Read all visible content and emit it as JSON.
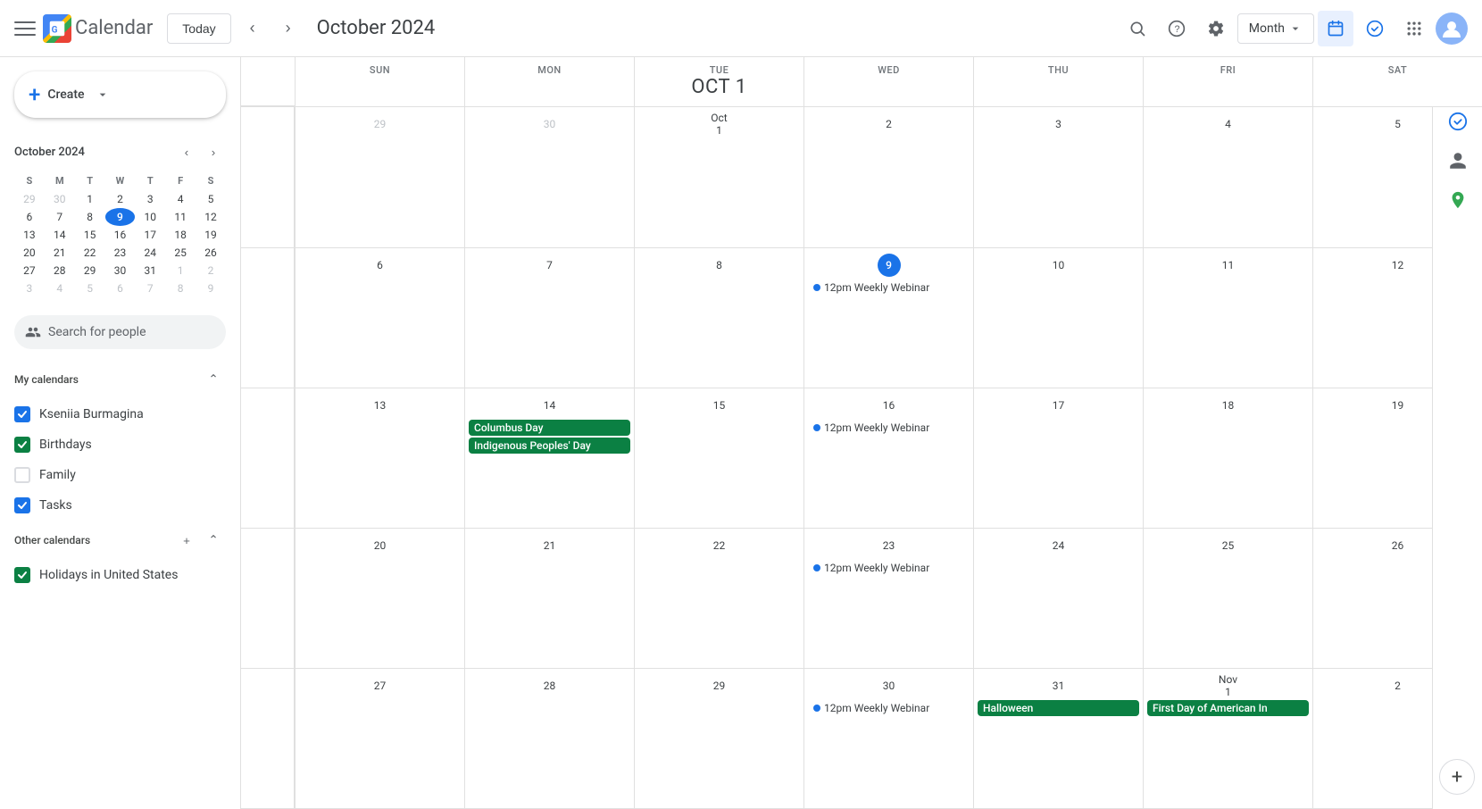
{
  "header": {
    "title": "October 2024",
    "today_label": "Today",
    "view_label": "Month",
    "logo_text": "Calendar"
  },
  "sidebar": {
    "create_label": "Create",
    "mini_cal": {
      "title": "October 2024",
      "days_header": [
        "S",
        "M",
        "T",
        "W",
        "T",
        "F",
        "S"
      ],
      "weeks": [
        [
          {
            "n": "29",
            "other": true
          },
          {
            "n": "30",
            "other": true
          },
          {
            "n": "1"
          },
          {
            "n": "2"
          },
          {
            "n": "3"
          },
          {
            "n": "4"
          },
          {
            "n": "5"
          }
        ],
        [
          {
            "n": "6"
          },
          {
            "n": "7"
          },
          {
            "n": "8"
          },
          {
            "n": "9",
            "today": true
          },
          {
            "n": "10"
          },
          {
            "n": "11"
          },
          {
            "n": "12"
          }
        ],
        [
          {
            "n": "13"
          },
          {
            "n": "14"
          },
          {
            "n": "15"
          },
          {
            "n": "16"
          },
          {
            "n": "17"
          },
          {
            "n": "18"
          },
          {
            "n": "19"
          }
        ],
        [
          {
            "n": "20"
          },
          {
            "n": "21"
          },
          {
            "n": "22"
          },
          {
            "n": "23"
          },
          {
            "n": "24"
          },
          {
            "n": "25"
          },
          {
            "n": "26"
          }
        ],
        [
          {
            "n": "27"
          },
          {
            "n": "28"
          },
          {
            "n": "29"
          },
          {
            "n": "30"
          },
          {
            "n": "31"
          },
          {
            "n": "1",
            "other": true
          },
          {
            "n": "2",
            "other": true
          }
        ],
        [
          {
            "n": "3",
            "other": true
          },
          {
            "n": "4",
            "other": true
          },
          {
            "n": "5",
            "other": true
          },
          {
            "n": "6",
            "other": true
          },
          {
            "n": "7",
            "other": true
          },
          {
            "n": "8",
            "other": true
          },
          {
            "n": "9",
            "other": true
          }
        ]
      ]
    },
    "search_placeholder": "Search for people",
    "my_calendars": {
      "label": "My calendars",
      "items": [
        {
          "name": "Kseniia Burmagina",
          "checked": true,
          "color": "#1a73e8"
        },
        {
          "name": "Birthdays",
          "checked": true,
          "color": "#0b8043"
        },
        {
          "name": "Family",
          "checked": false,
          "color": "none"
        },
        {
          "name": "Tasks",
          "checked": true,
          "color": "#1a73e8"
        }
      ]
    },
    "other_calendars": {
      "label": "Other calendars",
      "items": [
        {
          "name": "Holidays in United States",
          "checked": true,
          "color": "#0b8043"
        }
      ]
    }
  },
  "calendar": {
    "col_headers": [
      {
        "day": "SUN",
        "num": ""
      },
      {
        "day": "MON",
        "num": ""
      },
      {
        "day": "TUE",
        "num": "Oct 1",
        "is_today": false
      },
      {
        "day": "WED",
        "num": ""
      },
      {
        "day": "THU",
        "num": ""
      },
      {
        "day": "FRI",
        "num": ""
      },
      {
        "day": "SAT",
        "num": ""
      }
    ],
    "weeks": [
      {
        "days": [
          {
            "num": "29",
            "other": true,
            "events": []
          },
          {
            "num": "30",
            "other": true,
            "events": []
          },
          {
            "num": "Oct 1",
            "other": false,
            "events": []
          },
          {
            "num": "2",
            "other": false,
            "events": []
          },
          {
            "num": "3",
            "other": false,
            "events": []
          },
          {
            "num": "4",
            "other": false,
            "events": []
          },
          {
            "num": "5",
            "other": false,
            "events": []
          }
        ]
      },
      {
        "days": [
          {
            "num": "6",
            "other": false,
            "events": []
          },
          {
            "num": "7",
            "other": false,
            "events": []
          },
          {
            "num": "8",
            "other": false,
            "events": []
          },
          {
            "num": "9",
            "today": true,
            "other": false,
            "events": [
              {
                "type": "dot",
                "text": "12pm Weekly Webinar"
              }
            ]
          },
          {
            "num": "10",
            "other": false,
            "events": []
          },
          {
            "num": "11",
            "other": false,
            "events": []
          },
          {
            "num": "12",
            "other": false,
            "events": []
          }
        ]
      },
      {
        "days": [
          {
            "num": "13",
            "other": false,
            "events": []
          },
          {
            "num": "14",
            "other": false,
            "events": [
              {
                "type": "chip",
                "text": "Columbus Day",
                "color": "green"
              },
              {
                "type": "chip",
                "text": "Indigenous Peoples' Day",
                "color": "green"
              }
            ]
          },
          {
            "num": "15",
            "other": false,
            "events": []
          },
          {
            "num": "16",
            "other": false,
            "events": [
              {
                "type": "dot",
                "text": "12pm Weekly Webinar"
              }
            ]
          },
          {
            "num": "17",
            "other": false,
            "events": []
          },
          {
            "num": "18",
            "other": false,
            "events": []
          },
          {
            "num": "19",
            "other": false,
            "events": []
          }
        ]
      },
      {
        "days": [
          {
            "num": "20",
            "other": false,
            "events": []
          },
          {
            "num": "21",
            "other": false,
            "events": []
          },
          {
            "num": "22",
            "other": false,
            "events": []
          },
          {
            "num": "23",
            "other": false,
            "events": [
              {
                "type": "dot",
                "text": "12pm Weekly Webinar"
              }
            ]
          },
          {
            "num": "24",
            "other": false,
            "events": []
          },
          {
            "num": "25",
            "other": false,
            "events": []
          },
          {
            "num": "26",
            "other": false,
            "events": []
          }
        ]
      },
      {
        "days": [
          {
            "num": "27",
            "other": false,
            "events": []
          },
          {
            "num": "28",
            "other": false,
            "events": []
          },
          {
            "num": "29",
            "other": false,
            "events": []
          },
          {
            "num": "30",
            "other": false,
            "events": [
              {
                "type": "dot",
                "text": "12pm Weekly Webinar"
              }
            ]
          },
          {
            "num": "31",
            "other": false,
            "events": [
              {
                "type": "chip",
                "text": "Halloween",
                "color": "green"
              }
            ]
          },
          {
            "num": "Nov 1",
            "other": false,
            "events": [
              {
                "type": "chip",
                "text": "First Day of American In",
                "color": "green"
              }
            ]
          },
          {
            "num": "2",
            "other": false,
            "events": []
          }
        ]
      }
    ]
  }
}
